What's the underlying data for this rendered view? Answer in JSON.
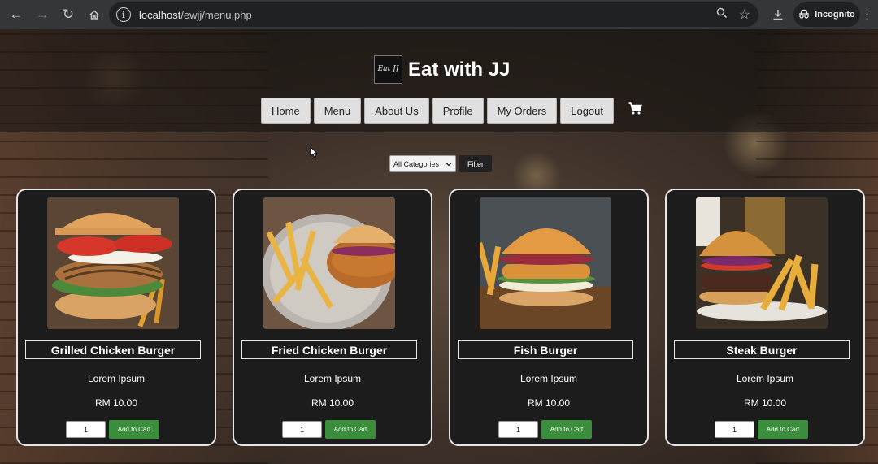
{
  "browser": {
    "url_host": "localhost",
    "url_path": "/ewjj/menu.php",
    "incognito_label": "Incognito"
  },
  "site": {
    "logo_text": "Eat JJ",
    "brand_name": "Eat with JJ",
    "nav": [
      "Home",
      "Menu",
      "About Us",
      "Profile",
      "My Orders",
      "Logout"
    ],
    "cart_icon": "cart-icon"
  },
  "filter": {
    "category_selected": "All Categories",
    "button_label": "Filter"
  },
  "products": [
    {
      "name": "Grilled Chicken Burger",
      "description": "Lorem Ipsum",
      "price": "RM 10.00",
      "qty": "1",
      "add_label": "Add to Cart"
    },
    {
      "name": "Fried Chicken Burger",
      "description": "Lorem Ipsum",
      "price": "RM 10.00",
      "qty": "1",
      "add_label": "Add to Cart"
    },
    {
      "name": "Fish Burger",
      "description": "Lorem Ipsum",
      "price": "RM 10.00",
      "qty": "1",
      "add_label": "Add to Cart"
    },
    {
      "name": "Steak Burger",
      "description": "Lorem Ipsum",
      "price": "RM 10.00",
      "qty": "1",
      "add_label": "Add to Cart"
    }
  ],
  "colors": {
    "add_to_cart": "#3b8e3b",
    "card_background": "#1c1c1c",
    "nav_button": "#e0e0e0"
  }
}
